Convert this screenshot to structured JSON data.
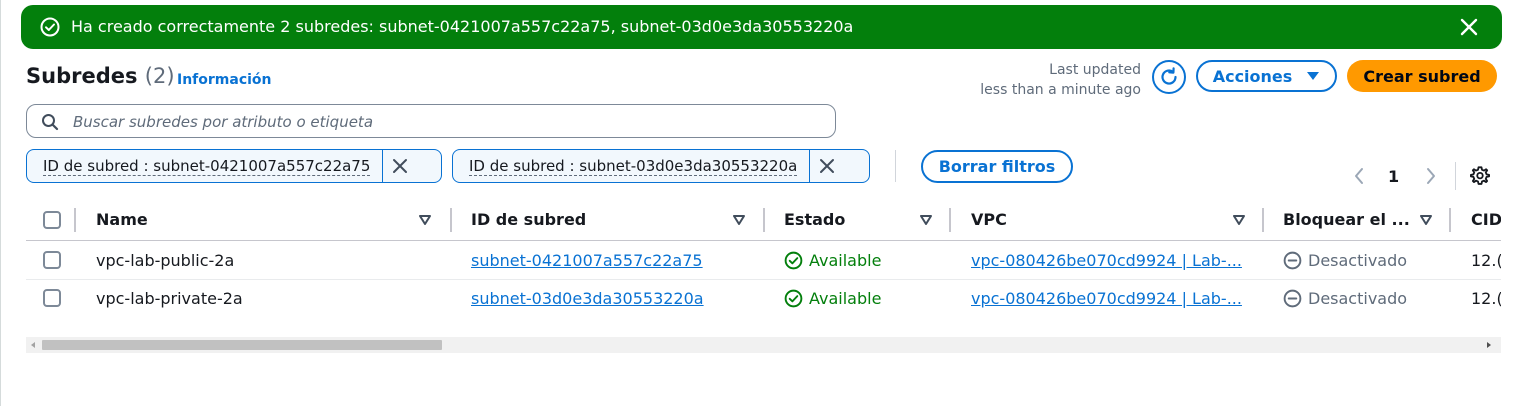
{
  "flash": {
    "message": "Ha creado correctamente 2 subredes: subnet-0421007a557c22a75, subnet-03d0e3da30553220a",
    "background": "#037f0c"
  },
  "header": {
    "title": "Subredes",
    "count": "(2)",
    "info_link": "Información",
    "last_updated_label": "Last updated",
    "last_updated_value": "less than a minute ago",
    "actions_label": "Acciones",
    "create_label": "Crear subred"
  },
  "search": {
    "placeholder": "Buscar subredes por atributo o etiqueta"
  },
  "filters": {
    "tokens": [
      {
        "label": "ID de subred : subnet-0421007a557c22a75"
      },
      {
        "label": "ID de subred : subnet-03d0e3da30553220a"
      }
    ],
    "clear_label": "Borrar filtros"
  },
  "pagination": {
    "current_page": "1"
  },
  "table": {
    "columns": [
      "Name",
      "ID de subred",
      "Estado",
      "VPC",
      "Bloquear el ...",
      "CID"
    ],
    "rows": [
      {
        "name": "vpc-lab-public-2a",
        "subnet_id": "subnet-0421007a557c22a75",
        "status": "Available",
        "vpc": "vpc-080426be070cd9924 | Lab-...",
        "block": "Desactivado",
        "cidr": "12.("
      },
      {
        "name": "vpc-lab-private-2a",
        "subnet_id": "subnet-03d0e3da30553220a",
        "status": "Available",
        "vpc": "vpc-080426be070cd9924 | Lab-...",
        "block": "Desactivado",
        "cidr": "12.("
      }
    ]
  },
  "colors": {
    "accent": "#0972d3",
    "primary_button": "#ff9900",
    "success": "#037f0c"
  }
}
